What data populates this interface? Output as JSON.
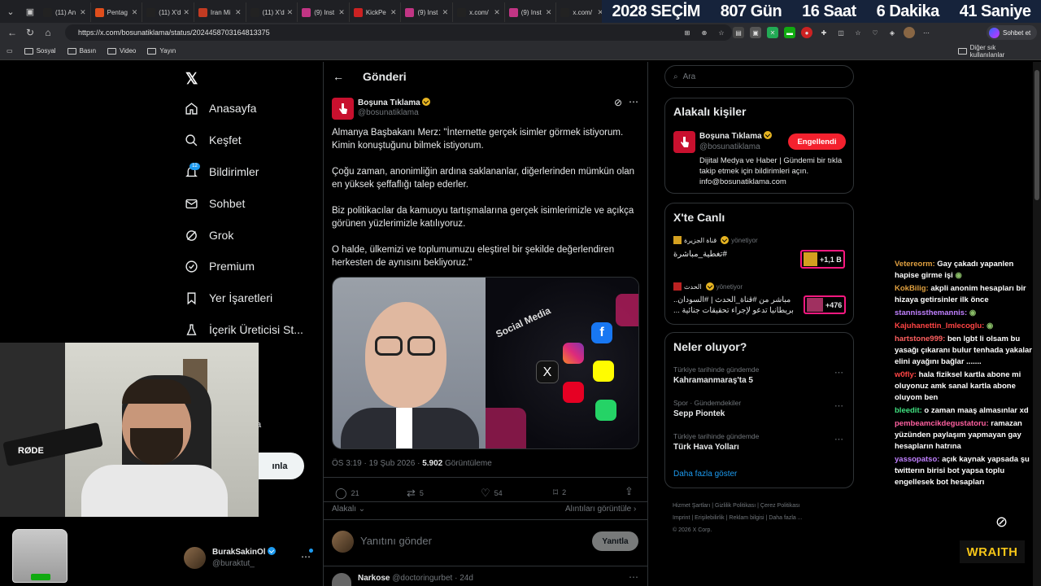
{
  "browser": {
    "tabs": [
      {
        "label": "(11) An",
        "icon": "x-icon",
        "color": "#222222"
      },
      {
        "label": "Pentag",
        "icon": "brave-icon",
        "color": "#e04e1c"
      },
      {
        "label": "(11) X'd",
        "icon": "x-icon",
        "color": "#222222"
      },
      {
        "label": "Iran Mi",
        "icon": "news-icon",
        "color": "#c23b22"
      },
      {
        "label": "(11) X'd",
        "icon": "x-icon",
        "color": "#222222"
      },
      {
        "label": "(9) Inst",
        "icon": "instagram-icon",
        "color": "#c13584"
      },
      {
        "label": "KickPe",
        "icon": "youtube-icon",
        "color": "#cc2222"
      },
      {
        "label": "(9) Inst",
        "icon": "instagram-icon",
        "color": "#c13584"
      },
      {
        "label": "x.com/",
        "icon": "x-icon",
        "color": "#222222"
      },
      {
        "label": "(9) Inst",
        "icon": "instagram-icon",
        "color": "#c13584"
      },
      {
        "label": "x.com/",
        "icon": "x-icon",
        "color": "#222222"
      }
    ],
    "url": "https://x.com/bosunatiklama/status/2024458703164813375",
    "chat_button": "Sohbet et",
    "bookmarks": [
      "Sosyal",
      "Basın",
      "Video",
      "Yayın"
    ],
    "other_bookmarks": "Diğer sık kullanılanlar"
  },
  "banner": {
    "year": "2028",
    "title": "SEÇİM",
    "days": "807",
    "days_label": "Gün",
    "hours": "16",
    "hours_label": "Saat",
    "minutes": "6",
    "minutes_label": "Dakika",
    "seconds": "41",
    "seconds_label": "Saniye"
  },
  "x": {
    "nav": [
      "Anasayfa",
      "Keşfet",
      "Bildirimler",
      "Sohbet",
      "Grok",
      "Premium",
      "Yer İşaretleri",
      "İçerik Üreticisi St..."
    ],
    "notif_badge": "12",
    "post_button_fragment": "ınla",
    "fragment_a": "a",
    "profile": {
      "name": "BurakSakinOl",
      "handle": "@buraktut_"
    },
    "header": "Gönderi",
    "post": {
      "author": "Boşuna Tıklama",
      "handle": "@bosunatiklama",
      "p1": "Almanya Başbakanı Merz: \"İnternette gerçek isimler görmek istiyorum. Kimin konuştuğunu bilmek istiyorum.",
      "p2": "Çoğu zaman, anonimliğin ardına saklananlar, diğerlerinden mümkün olan en yüksek şeffaflığı talep ederler.",
      "p3": "Biz politikacılar da kamuoyu tartışmalarına gerçek isimlerimizle ve açıkça görünen yüzlerimizle katılıyoruz.",
      "p4": "O halde, ülkemizi ve toplumumuzu eleştirel bir şekilde değerlendiren herkesten de aynısını bekliyoruz.\"",
      "image_caption": "Social Media",
      "time": "ÖS 3:19 · 19 Şub 2026 ·",
      "views": "5.902",
      "views_label": "Görüntüleme",
      "replies": "21",
      "reposts": "5",
      "likes": "54",
      "bookmarks": "2",
      "relevant": "Alakalı",
      "quotes": "Alıntıları görüntüle",
      "reply_placeholder": "Yanıtını gönder",
      "reply_button": "Yanıtla"
    },
    "next_reply": {
      "name": "Narkose",
      "handle": "@doctoringurbet",
      "age": "· 24d"
    },
    "search_placeholder": "Ara",
    "related": {
      "title": "Alakalı kişiler",
      "name": "Boşuna Tıklama",
      "handle": "@bosunatiklama",
      "button": "Engellendi",
      "bio": "Dijital Medya ve Haber | Gündemi bir tıkla takip etmek için bildirimleri açın. info@bosunatiklama.com"
    },
    "live": {
      "title": "X'te Canlı",
      "items": [
        {
          "host": "قناة الجزيرة",
          "status": "yönetiyor",
          "text": "تغطية_مباشرة#",
          "count": "+1,1 B"
        },
        {
          "host": "الحدث",
          "status": "yönetiyor",
          "text": "مباشر من #قناة_الحدث | #السودان.. بريطانيا تدعو لإجراء تحقيقات جنائية ...",
          "count": "+476"
        }
      ]
    },
    "trends": {
      "title": "Neler oluyor?",
      "items": [
        {
          "context": "Türkiye tarihinde gündemde",
          "name": "Kahramanmaraş'ta 5"
        },
        {
          "context": "Spor · Gündemdekiler",
          "name": "Sepp Piontek"
        },
        {
          "context": "Türkiye tarihinde gündemde",
          "name": "Türk Hava Yolları"
        }
      ],
      "more": "Daha fazla göster"
    },
    "footer": {
      "l1": "Hizmet Şartları",
      "l2": "Gizlilik Politikası",
      "l3": "Çerez Politikası",
      "l4": "Imprint",
      "l5": "Erişilebilirlik",
      "l6": "Reklam bilgisi",
      "l7": "Daha fazla ...",
      "copy": "© 2026 X Corp."
    }
  },
  "stream": {
    "mic_brand": "RØDE",
    "brand": "WRAITH",
    "chat": [
      {
        "user": "Vetereorm:",
        "color": "#e0a040",
        "msg": "Gay çakadı yapanlen hapise girme işi",
        "emote": true
      },
      {
        "user": "KokBilig:",
        "color": "#e0a040",
        "msg": "akpli anonim hesapları bir hizaya getirsinler ilk önce",
        "emote": false
      },
      {
        "user": "stannissthemannis:",
        "color": "#c080ff",
        "msg": "",
        "emote": true
      },
      {
        "user": "Kajuhanettin_Imlecoglu:",
        "color": "#ff4444",
        "msg": "",
        "emote": true
      },
      {
        "user": "hartstone999:",
        "color": "#ff6060",
        "msg": "ben lgbt li olsam bu yasağı çıkaranı bulur tenhada yakalar elini ayağını bağlar .......",
        "emote": false
      },
      {
        "user": "w0fly:",
        "color": "#ff4444",
        "msg": "hala fiziksel kartla abone mi oluyonuz amk sanal kartla abone oluyom ben",
        "emote": false
      },
      {
        "user": "bleedit:",
        "color": "#40e080",
        "msg": "o zaman maaş almasınlar xd",
        "emote": false
      },
      {
        "user": "pembeamcikdegustatoru:",
        "color": "#ff60a0",
        "msg": "ramazan yüzünden paylaşım yapmayan gay hesapların hatrına",
        "emote": false
      },
      {
        "user": "yassopatso:",
        "color": "#c080ff",
        "msg": "açık kaynak yapsada şu twitterın birisi bot yapsa toplu engellesek bot hesapları",
        "emote": false
      }
    ]
  }
}
